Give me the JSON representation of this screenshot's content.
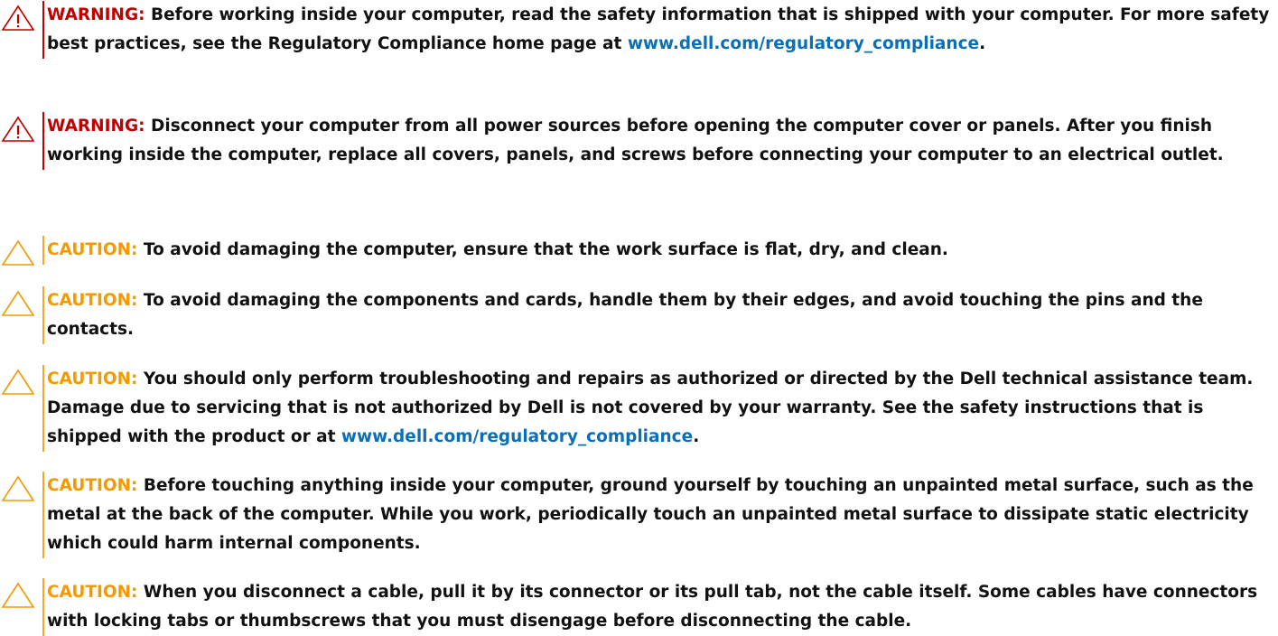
{
  "notices": [
    {
      "kind": "warning",
      "icon": "warning-triangle-icon",
      "label": "WARNING:",
      "text_before": " Before working inside your computer, read the safety information that is shipped with your computer. For more safety best practices, see the Regulatory Compliance home page at ",
      "link": "www.dell.com/regulatory_compliance",
      "text_after": "."
    },
    {
      "kind": "warning",
      "icon": "warning-triangle-icon",
      "label": "WARNING:",
      "text_before": " Disconnect your computer from all power sources before opening the computer cover or panels. After you finish working inside the computer, replace all covers, panels, and screws before connecting your computer to an electrical outlet.",
      "link": "",
      "text_after": ""
    },
    {
      "kind": "caution",
      "icon": "caution-triangle-icon",
      "label": "CAUTION:",
      "text_before": " To avoid damaging the computer, ensure that the work surface is flat, dry, and clean.",
      "link": "",
      "text_after": ""
    },
    {
      "kind": "caution",
      "icon": "caution-triangle-icon",
      "label": "CAUTION:",
      "text_before": " To avoid damaging the components and cards, handle them by their edges, and avoid touching the pins and the contacts.",
      "link": "",
      "text_after": ""
    },
    {
      "kind": "caution",
      "icon": "caution-triangle-icon",
      "label": "CAUTION:",
      "text_before": " You should only perform troubleshooting and repairs as authorized or directed by the Dell technical assistance team. Damage due to servicing that is not authorized by Dell is not covered by your warranty. See the safety instructions that is shipped with the product or at ",
      "link": "www.dell.com/regulatory_compliance",
      "text_after": "."
    },
    {
      "kind": "caution",
      "icon": "caution-triangle-icon",
      "label": "CAUTION:",
      "text_before": " Before touching anything inside your computer, ground yourself by touching an unpainted metal surface, such as the metal at the back of the computer. While you work, periodically touch an unpainted metal surface to dissipate static electricity which could harm internal components.",
      "link": "",
      "text_after": ""
    },
    {
      "kind": "caution",
      "icon": "caution-triangle-icon",
      "label": "CAUTION:",
      "text_before": " When you disconnect a cable, pull it by its connector or its pull tab, not the cable itself. Some cables have connectors with locking tabs or thumbscrews that you must disengage before disconnecting the cable.",
      "link": "",
      "text_after": ""
    }
  ],
  "colors": {
    "warning": "#c00000",
    "caution": "#f29a00",
    "link": "#0b6fb8"
  }
}
